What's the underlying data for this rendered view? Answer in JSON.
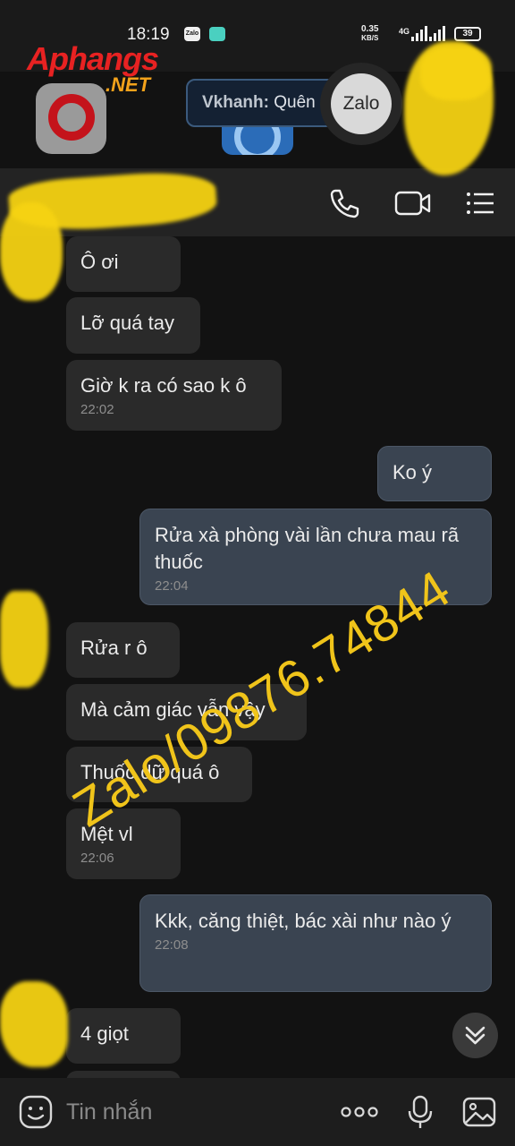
{
  "status_bar": {
    "time": "18:19",
    "zalo_icon": "Zalo",
    "net_speed_value": "0.35",
    "net_speed_unit": "KB/S",
    "network": "4G",
    "battery": "39"
  },
  "watermark": {
    "brand": "Aphangs",
    "domain": ".NET"
  },
  "overlay_notification": {
    "sender": "Vkhanh:",
    "preview": "Quên",
    "chat_head_label": "Zalo"
  },
  "header_icons": [
    "phone-icon",
    "video-call-icon",
    "menu-icon"
  ],
  "messages": [
    {
      "dir": "in",
      "text": "Ô ơi",
      "time": ""
    },
    {
      "dir": "in",
      "text": "Lỡ quá tay",
      "time": ""
    },
    {
      "dir": "in",
      "text": "Giờ k ra có sao k ô",
      "time": "22:02"
    },
    {
      "dir": "out",
      "text": "Ko ý",
      "time": ""
    },
    {
      "dir": "out",
      "text": "Rửa xà phòng vài lần chưa mau rã thuốc",
      "time": "22:04"
    },
    {
      "dir": "in",
      "text": "Rửa r ô",
      "time": ""
    },
    {
      "dir": "in",
      "text": "Mà cảm giác vẫn vậy",
      "time": ""
    },
    {
      "dir": "in",
      "text": "Thuốc dữ quá ô",
      "time": ""
    },
    {
      "dir": "in",
      "text": "Mệt vl",
      "time": "22:06"
    },
    {
      "dir": "out",
      "text": "Kkk, căng thiệt, bác xài như nào ý",
      "time": "22:08"
    },
    {
      "dir": "in",
      "text": "4 giọt",
      "time": ""
    }
  ],
  "overlay_text": "Zalo/09876.74844",
  "input_bar": {
    "placeholder": "Tin nhắn",
    "icons": [
      "sticker-icon",
      "more-icon",
      "microphone-icon",
      "image-icon"
    ]
  },
  "colors": {
    "background": "#121212",
    "incoming_bubble": "#2a2a2a",
    "outgoing_bubble": "#3a4451",
    "overlay_text": "#f0c41a",
    "redaction": "#f6d312"
  }
}
